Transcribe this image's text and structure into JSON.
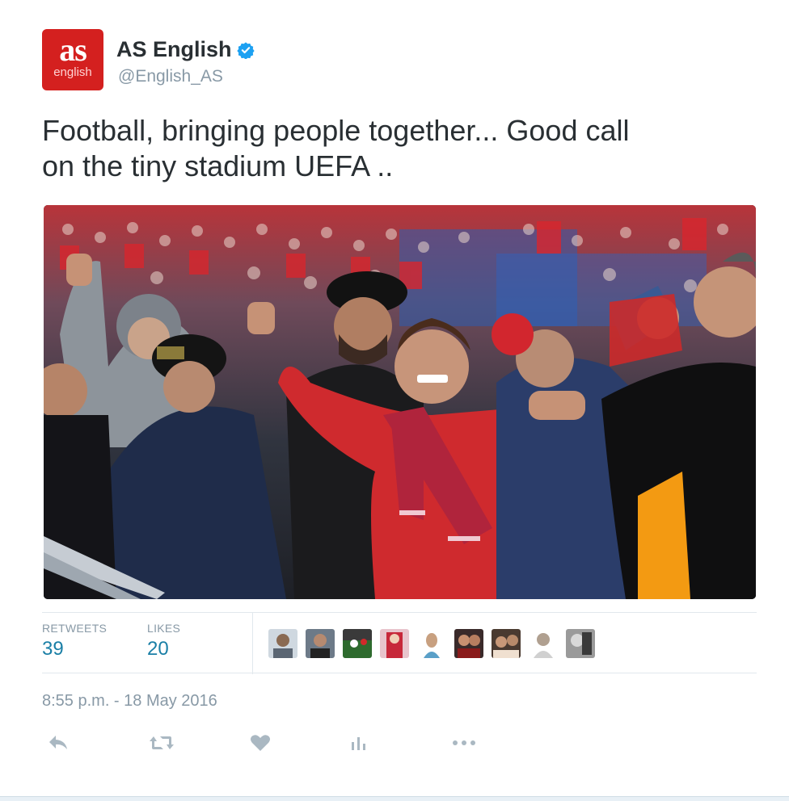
{
  "user": {
    "avatar_text": "as",
    "avatar_subtext": "english",
    "name": "AS English",
    "handle": "@English_AS"
  },
  "tweet": {
    "text_line1": "Football, bringing people together... Good call",
    "text_line2": "on the tiny stadium UEFA .."
  },
  "stats": {
    "retweets_label": "RETWEETS",
    "retweets_value": "39",
    "likes_label": "LIKES",
    "likes_value": "20",
    "liker_count_shown": 9
  },
  "timestamp": "8:55 p.m. - 18 May 2016",
  "actions": [
    "reply-icon",
    "retweet-icon",
    "heart-icon",
    "analytics-icon",
    "more-icon"
  ],
  "colors": {
    "brand_red": "#d4201f",
    "verified_blue": "#1da1f2",
    "link_blue": "#1a7fa6",
    "muted_gray": "#8899a6",
    "text": "#292f33"
  }
}
